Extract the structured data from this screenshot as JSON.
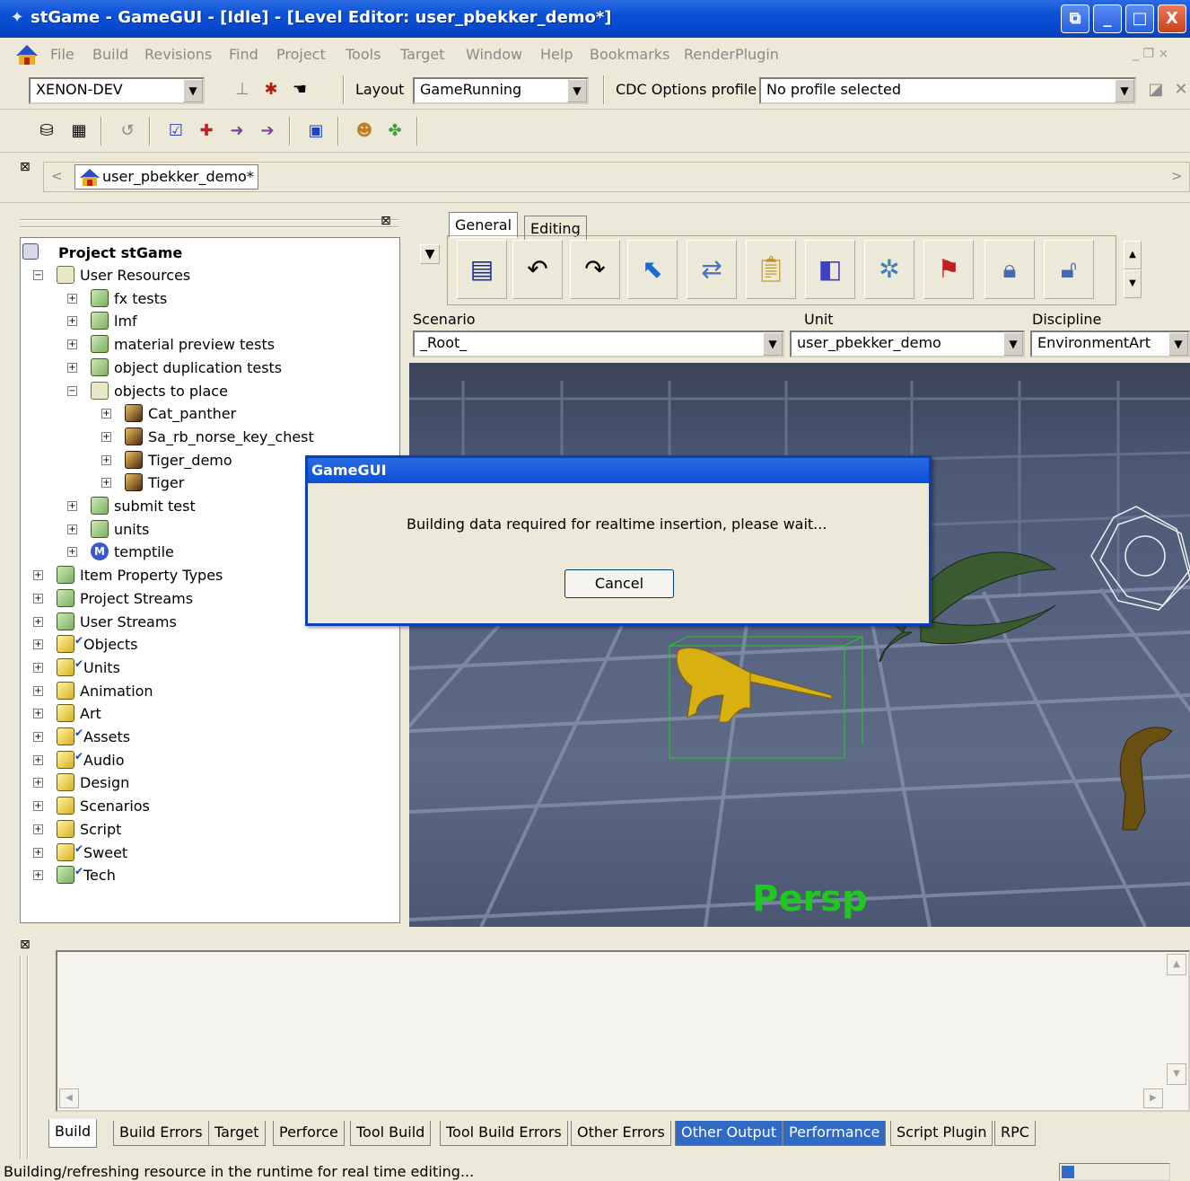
{
  "window": {
    "title": "stGame - GameGUI - [Idle] - [Level Editor: user_pbekker_demo*]",
    "buttons": {
      "restore": "⧉",
      "minimize": "_",
      "maximize": "□",
      "close": "X"
    }
  },
  "menubar": {
    "items": [
      "File",
      "Build",
      "Revisions",
      "Find",
      "Project",
      "Tools",
      "Target",
      "Window",
      "Help",
      "Bookmarks",
      "RenderPlugin"
    ],
    "mdi": "_ ❐ ×"
  },
  "toolbar1": {
    "target_combo": "XENON-DEV",
    "layout_label": "Layout",
    "layout_combo": "GameRunning",
    "cdc_label": "CDC Options profile",
    "cdc_combo": "No profile selected"
  },
  "breadcrumb": {
    "doc_tab": "user_pbekker_demo*",
    "nav_left": "<",
    "nav_right": ">"
  },
  "tree": {
    "root": "Project stGame",
    "items": [
      {
        "label": "User Resources",
        "icon": "folder-open",
        "indent": 1,
        "exp": "−"
      },
      {
        "label": "fx tests",
        "icon": "cube-green",
        "indent": 2,
        "exp": "+"
      },
      {
        "label": "lmf",
        "icon": "cube-green",
        "indent": 2,
        "exp": "+"
      },
      {
        "label": "material preview tests",
        "icon": "cube-green",
        "indent": 2,
        "exp": "+"
      },
      {
        "label": "object duplication tests",
        "icon": "cube-green",
        "indent": 2,
        "exp": "+"
      },
      {
        "label": "objects to place",
        "icon": "folder-open",
        "indent": 2,
        "exp": "−"
      },
      {
        "label": "Cat_panther",
        "icon": "cube-dark",
        "indent": 3,
        "exp": "+"
      },
      {
        "label": "Sa_rb_norse_key_chest",
        "icon": "cube-dark",
        "indent": 3,
        "exp": "+"
      },
      {
        "label": "Tiger_demo",
        "icon": "cube-dark",
        "indent": 3,
        "exp": "+"
      },
      {
        "label": "Tiger",
        "icon": "cube-dark",
        "indent": 3,
        "exp": "+"
      },
      {
        "label": "submit test",
        "icon": "cube-green",
        "indent": 2,
        "exp": "+"
      },
      {
        "label": "units",
        "icon": "cube-green",
        "indent": 2,
        "exp": "+"
      },
      {
        "label": "temptile",
        "icon": "m-icon",
        "indent": 2,
        "exp": "+"
      },
      {
        "label": "Item Property Types",
        "icon": "cube-green",
        "indent": 1,
        "exp": "+"
      },
      {
        "label": "Project Streams",
        "icon": "cube-green",
        "indent": 1,
        "exp": "+"
      },
      {
        "label": "User Streams",
        "icon": "cube-green",
        "indent": 1,
        "exp": "+"
      },
      {
        "label": "Objects",
        "icon": "cube-yellow",
        "indent": 1,
        "exp": "+",
        "check": true
      },
      {
        "label": "Units",
        "icon": "cube-yellow",
        "indent": 1,
        "exp": "+",
        "check": true
      },
      {
        "label": "Animation",
        "icon": "cube-yellow",
        "indent": 1,
        "exp": "+"
      },
      {
        "label": "Art",
        "icon": "cube-yellow",
        "indent": 1,
        "exp": "+"
      },
      {
        "label": "Assets",
        "icon": "cube-yellow",
        "indent": 1,
        "exp": "+",
        "check": true
      },
      {
        "label": "Audio",
        "icon": "cube-yellow",
        "indent": 1,
        "exp": "+",
        "check": true
      },
      {
        "label": "Design",
        "icon": "cube-yellow",
        "indent": 1,
        "exp": "+"
      },
      {
        "label": "Scenarios",
        "icon": "cube-yellow",
        "indent": 1,
        "exp": "+"
      },
      {
        "label": "Script",
        "icon": "cube-yellow",
        "indent": 1,
        "exp": "+"
      },
      {
        "label": "Sweet",
        "icon": "cube-yellow",
        "indent": 1,
        "exp": "+",
        "check": true
      },
      {
        "label": "Tech",
        "icon": "cube-green",
        "indent": 1,
        "exp": "+",
        "check": true
      }
    ]
  },
  "editor": {
    "tabs": [
      "General",
      "Editing"
    ],
    "scenario_label": "Scenario",
    "scenario_value": "_Root_",
    "unit_label": "Unit",
    "unit_value": "user_pbekker_demo",
    "discipline_label": "Discipline",
    "discipline_value": "EnvironmentArt",
    "viewport_label": "Persp"
  },
  "dialog": {
    "title": "GameGUI",
    "message": "Building data required for realtime insertion, please wait...",
    "cancel": "Cancel"
  },
  "output_tabs": [
    "Build",
    "Build Errors",
    "Target",
    "Perforce",
    "Tool Build",
    "Tool Build Errors",
    "Other Errors",
    "Other Output",
    "Performance",
    "Script Plugin",
    "RPC"
  ],
  "status": {
    "text": "Building/refreshing resource in the runtime for real time editing..."
  },
  "colors": {
    "title_blue": "#0a50d8",
    "highlight_tab": "#316ac5",
    "persp_green": "#1ec81e",
    "viewport_bg": "#56627e"
  }
}
